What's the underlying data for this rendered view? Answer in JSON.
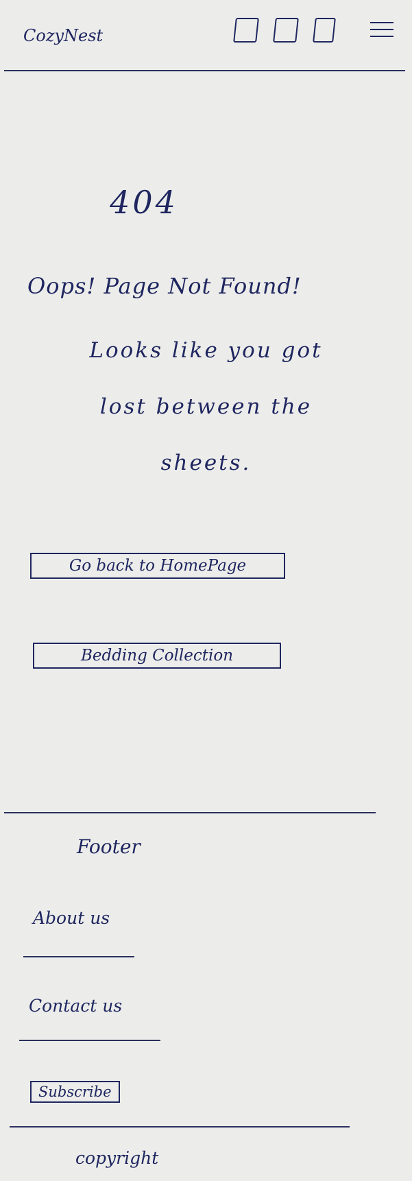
{
  "header": {
    "logo": "CozyNest",
    "icons": [
      "placeholder-icon-1",
      "placeholder-icon-2",
      "placeholder-icon-3",
      "menu-icon"
    ]
  },
  "main": {
    "code": "404",
    "title": "Oops! Page Not Found!",
    "message": "Looks like you got lost between the sheets.",
    "buttons": {
      "home": "Go back to HomePage",
      "bedding": "Bedding Collection"
    }
  },
  "footer": {
    "title": "Footer",
    "about": "About us",
    "contact": "Contact us",
    "subscribe": "Subscribe",
    "copyright": "copyright"
  }
}
